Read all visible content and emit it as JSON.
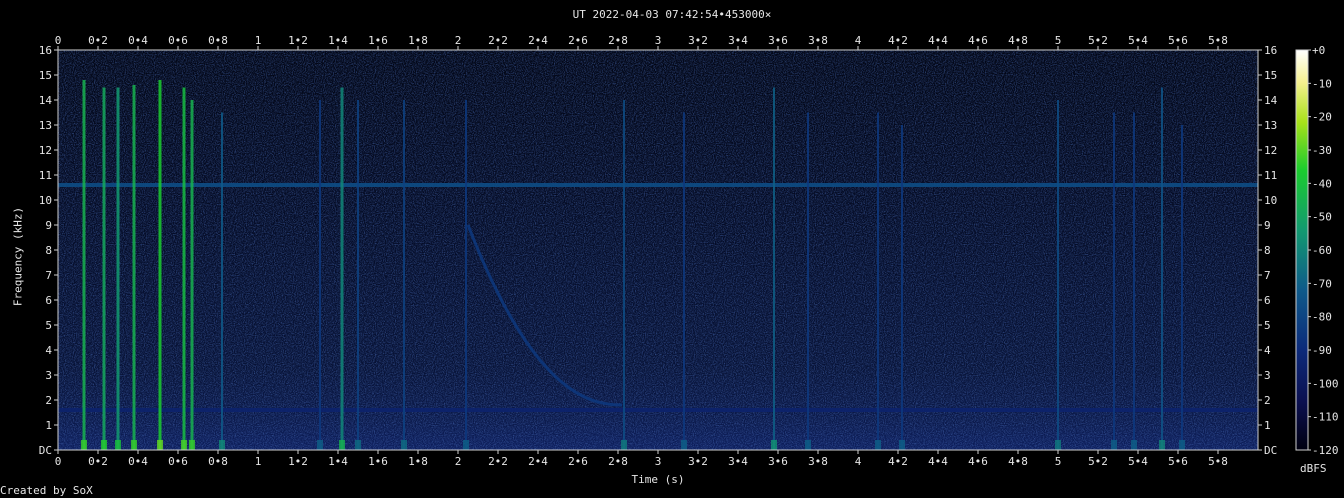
{
  "chart_data": {
    "type": "heatmap",
    "title": "UT 2022-04-03 07:42:54•453000×",
    "xlabel": "Time (s)",
    "ylabel": "Frequency (kHz)",
    "xlim": [
      0,
      6.0
    ],
    "ylim": [
      0,
      16
    ],
    "x_ticks": [
      "0",
      "0•2",
      "0•4",
      "0•6",
      "0•8",
      "1",
      "1•2",
      "1•4",
      "1•6",
      "1•8",
      "2",
      "2•2",
      "2•4",
      "2•6",
      "2•8",
      "3",
      "3•2",
      "3•4",
      "3•6",
      "3•8",
      "4",
      "4•2",
      "4•4",
      "4•6",
      "4•8",
      "5",
      "5•2",
      "5•4",
      "5•6",
      "5•8"
    ],
    "y_ticks": [
      "DC",
      "1",
      "2",
      "3",
      "4",
      "5",
      "6",
      "7",
      "8",
      "9",
      "10",
      "11",
      "12",
      "13",
      "14",
      "15",
      "16"
    ],
    "colorbar": {
      "label": "dBFS",
      "range": [
        -120,
        0
      ],
      "ticks": [
        "+0",
        "-10",
        "-20",
        "-30",
        "-40",
        "-50",
        "-60",
        "-70",
        "-80",
        "-90",
        "-100",
        "-110",
        "-120"
      ]
    },
    "background_level_dbfs": -105,
    "tones": [
      {
        "freq_khz": 10.6,
        "level_dbfs": -88
      },
      {
        "freq_khz": 1.6,
        "level_dbfs": -98
      }
    ],
    "impulses": [
      {
        "time_s": 0.13,
        "top_khz": 14.8,
        "level_dbfs": -70
      },
      {
        "time_s": 0.23,
        "top_khz": 14.5,
        "level_dbfs": -72
      },
      {
        "time_s": 0.3,
        "top_khz": 14.5,
        "level_dbfs": -75
      },
      {
        "time_s": 0.38,
        "top_khz": 14.6,
        "level_dbfs": -70
      },
      {
        "time_s": 0.51,
        "top_khz": 14.8,
        "level_dbfs": -65
      },
      {
        "time_s": 0.63,
        "top_khz": 14.5,
        "level_dbfs": -68
      },
      {
        "time_s": 0.67,
        "top_khz": 14.0,
        "level_dbfs": -70
      },
      {
        "time_s": 0.82,
        "top_khz": 13.5,
        "level_dbfs": -85
      },
      {
        "time_s": 1.31,
        "top_khz": 14.0,
        "level_dbfs": -92
      },
      {
        "time_s": 1.42,
        "top_khz": 14.5,
        "level_dbfs": -78
      },
      {
        "time_s": 1.5,
        "top_khz": 14.0,
        "level_dbfs": -90
      },
      {
        "time_s": 1.73,
        "top_khz": 14.0,
        "level_dbfs": -90
      },
      {
        "time_s": 2.04,
        "top_khz": 14.0,
        "level_dbfs": -92
      },
      {
        "time_s": 2.83,
        "top_khz": 14.0,
        "level_dbfs": -88
      },
      {
        "time_s": 3.13,
        "top_khz": 13.5,
        "level_dbfs": -92
      },
      {
        "time_s": 3.58,
        "top_khz": 14.5,
        "level_dbfs": -84
      },
      {
        "time_s": 3.75,
        "top_khz": 13.5,
        "level_dbfs": -92
      },
      {
        "time_s": 4.1,
        "top_khz": 13.5,
        "level_dbfs": -92
      },
      {
        "time_s": 4.22,
        "top_khz": 13.0,
        "level_dbfs": -92
      },
      {
        "time_s": 5.0,
        "top_khz": 14.0,
        "level_dbfs": -88
      },
      {
        "time_s": 5.28,
        "top_khz": 13.5,
        "level_dbfs": -92
      },
      {
        "time_s": 5.38,
        "top_khz": 13.5,
        "level_dbfs": -92
      },
      {
        "time_s": 5.52,
        "top_khz": 14.5,
        "level_dbfs": -86
      },
      {
        "time_s": 5.62,
        "top_khz": 13.0,
        "level_dbfs": -92
      }
    ],
    "sweep": {
      "start_time_s": 2.05,
      "start_khz": 9.0,
      "end_time_s": 2.82,
      "end_khz": 1.8,
      "level_dbfs": -92
    },
    "footer_text": "Created by SoX"
  }
}
